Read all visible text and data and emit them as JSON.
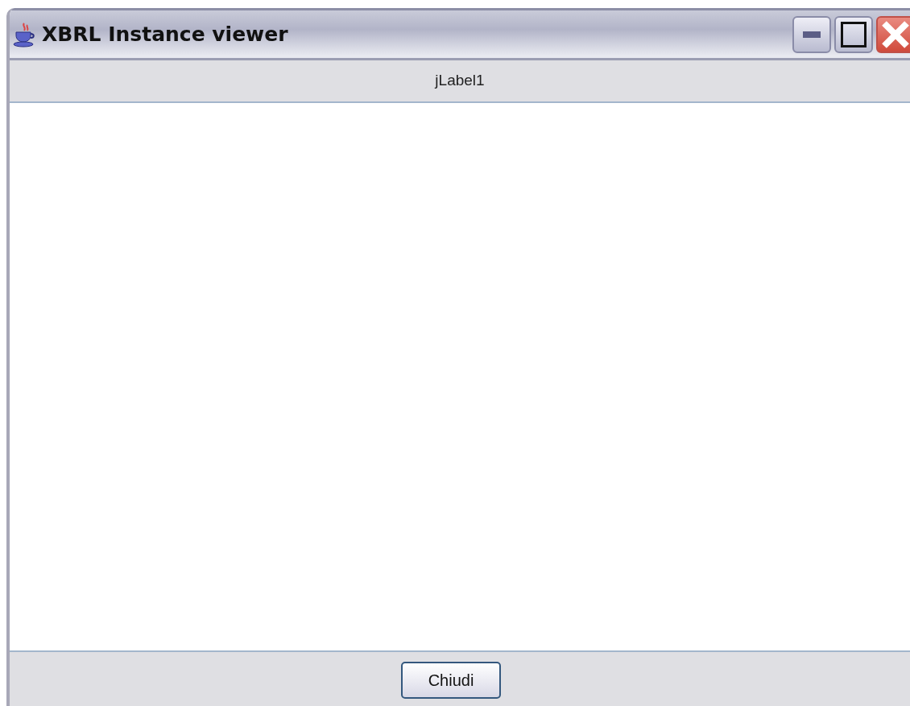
{
  "window": {
    "title": "XBRL Instance viewer"
  },
  "header_label": "jLabel1",
  "buttons": [
    {
      "label": "Chiudi"
    }
  ]
}
